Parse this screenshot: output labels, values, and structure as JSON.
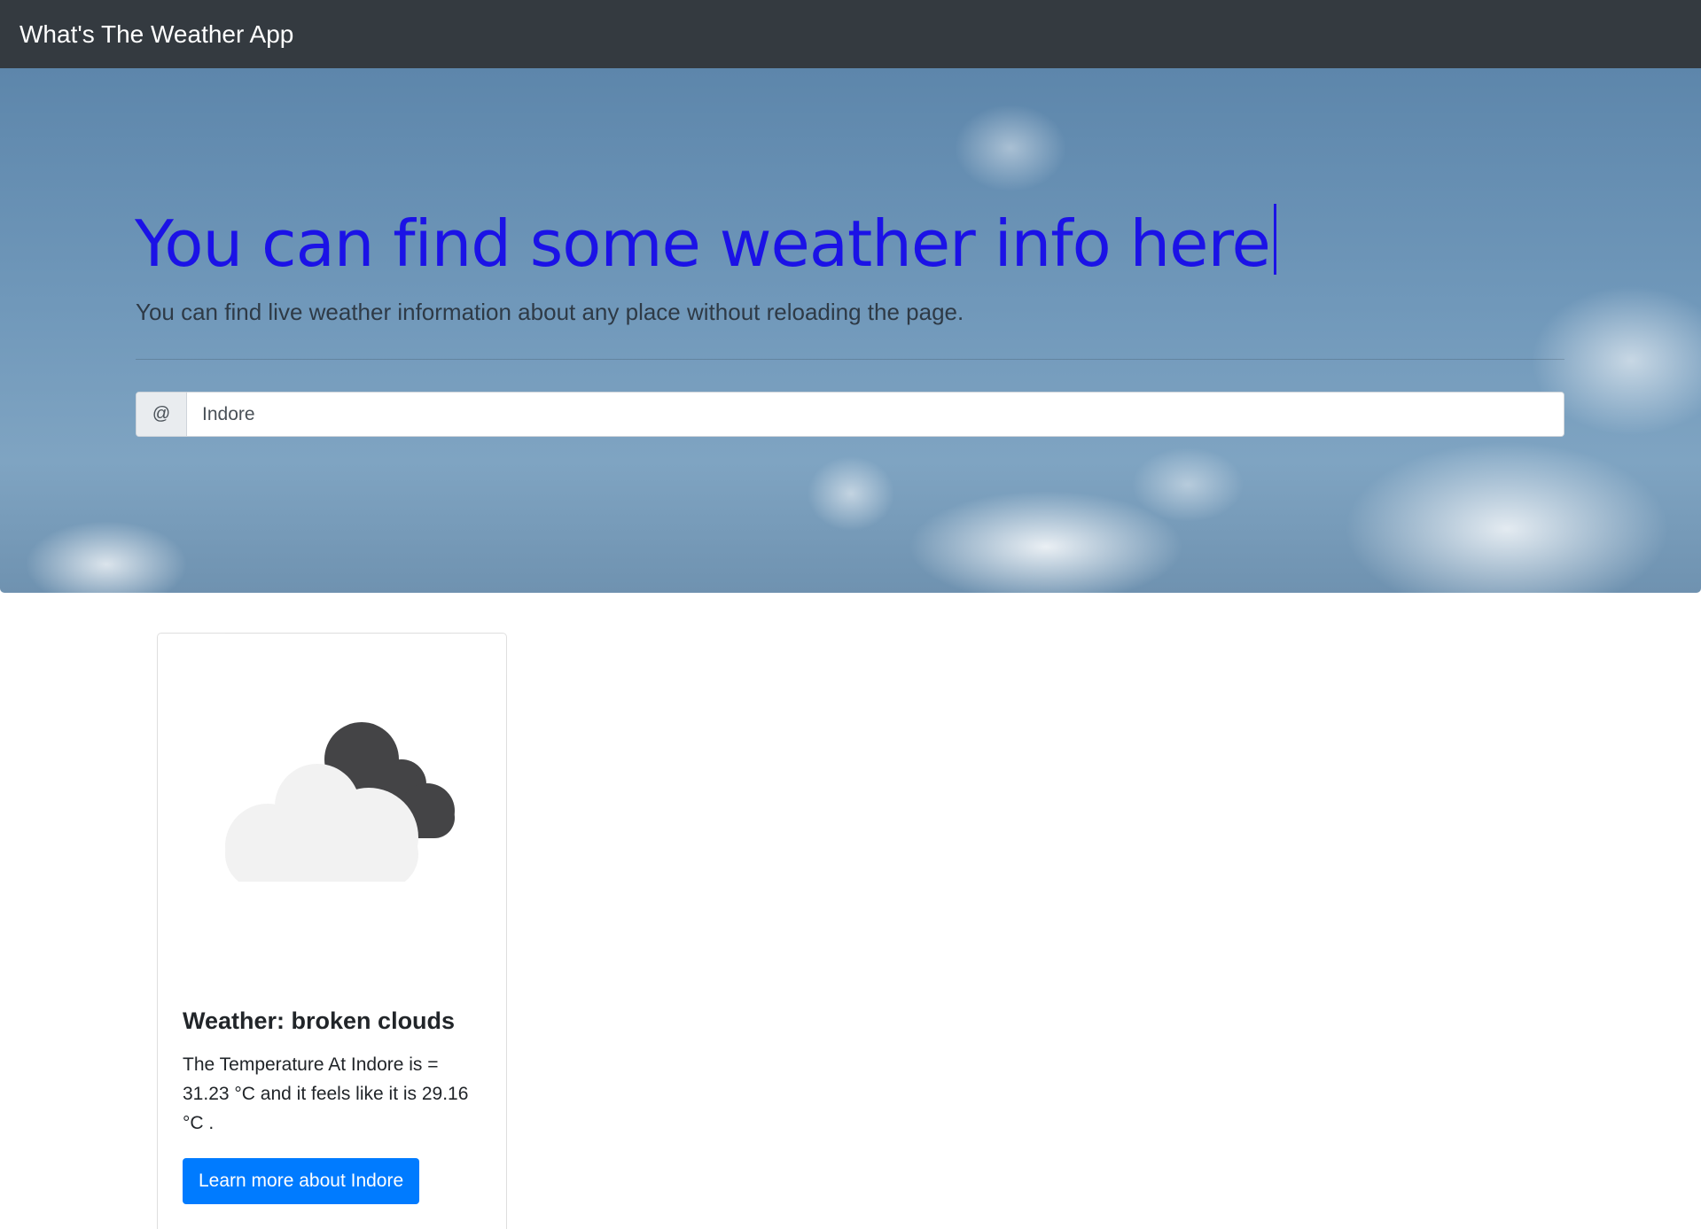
{
  "navbar": {
    "brand": "What's The Weather App",
    "background_color": "#343a40"
  },
  "hero": {
    "title": "You can find some weather info here",
    "lead": "You can find live weather information about any place without reloading the page.",
    "title_color": "#1b12e6"
  },
  "search": {
    "prefix": "@",
    "value": "Indore"
  },
  "weather_card": {
    "icon": "broken-clouds-icon",
    "title": "Weather: broken clouds",
    "text": "The Temperature At Indore is = 31.23 °C and it feels like it is 29.16 °C .",
    "button_label": "Learn more about Indore",
    "button_color": "#007bff"
  }
}
